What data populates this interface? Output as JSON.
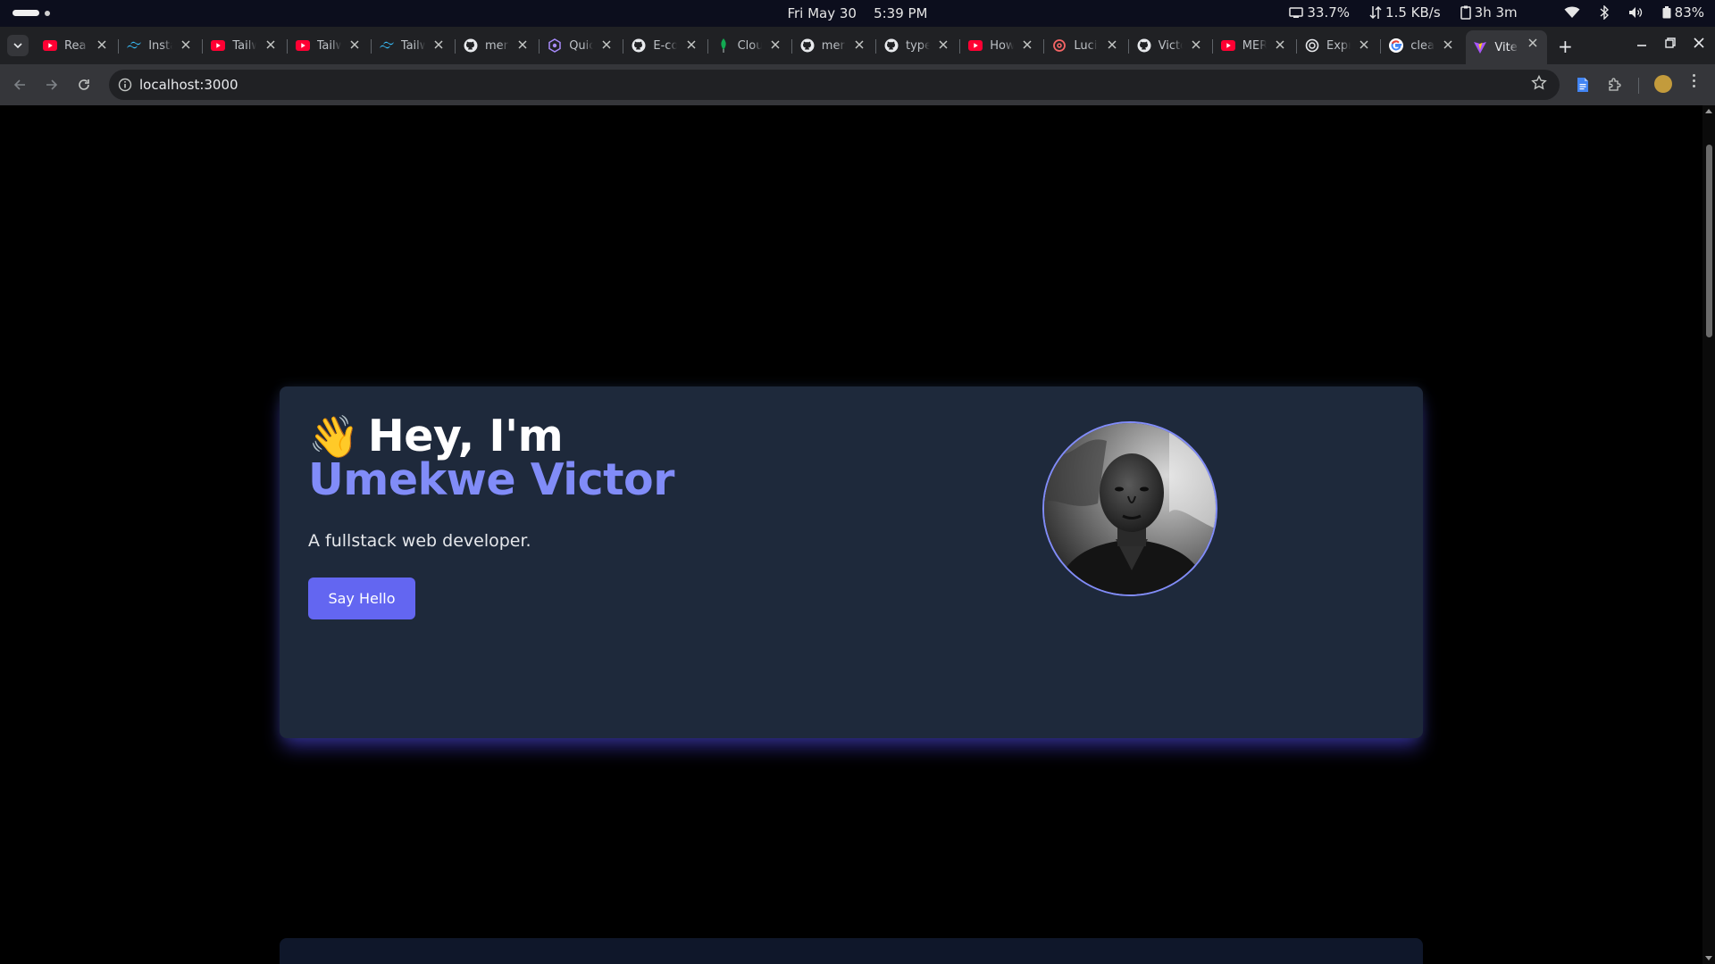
{
  "system": {
    "date": "Fri May 30",
    "time": "5:39 PM",
    "cpu": "33.7%",
    "network": "1.5 KB/s",
    "battery_time": "3h 3m",
    "battery_percent": "83%"
  },
  "tabs": [
    {
      "title": "Rea",
      "icon": "youtube-icon"
    },
    {
      "title": "Insta",
      "icon": "tailwind-icon"
    },
    {
      "title": "Tailw",
      "icon": "youtube-icon"
    },
    {
      "title": "Tailw",
      "icon": "youtube-icon"
    },
    {
      "title": "Tailw",
      "icon": "tailwind-icon"
    },
    {
      "title": "mern",
      "icon": "github-icon"
    },
    {
      "title": "Quic",
      "icon": "quickref-icon"
    },
    {
      "title": "E-co",
      "icon": "github-icon"
    },
    {
      "title": "Clou",
      "icon": "mongodb-icon"
    },
    {
      "title": "mern",
      "icon": "github-icon"
    },
    {
      "title": "type",
      "icon": "github-icon"
    },
    {
      "title": "How",
      "icon": "youtube-icon"
    },
    {
      "title": "Luci",
      "icon": "lucide-icon"
    },
    {
      "title": "Victo",
      "icon": "github-icon"
    },
    {
      "title": "MER",
      "icon": "youtube-icon"
    },
    {
      "title": "Expr",
      "icon": "openai-icon"
    },
    {
      "title": "clea",
      "icon": "google-icon"
    },
    {
      "title": "Vite",
      "icon": "vite-icon",
      "active": true
    }
  ],
  "address_bar": {
    "url": "localhost:3000"
  },
  "hero": {
    "wave_emoji": "👋",
    "greeting": "Hey, I'm",
    "name": "Umekwe Victor",
    "tagline": "A fullstack web developer.",
    "button_label": "Say Hello"
  },
  "colors": {
    "page_background": "#000000",
    "card_background": "#1e293b",
    "accent": "#6366f1",
    "name_color": "#818cf8"
  }
}
